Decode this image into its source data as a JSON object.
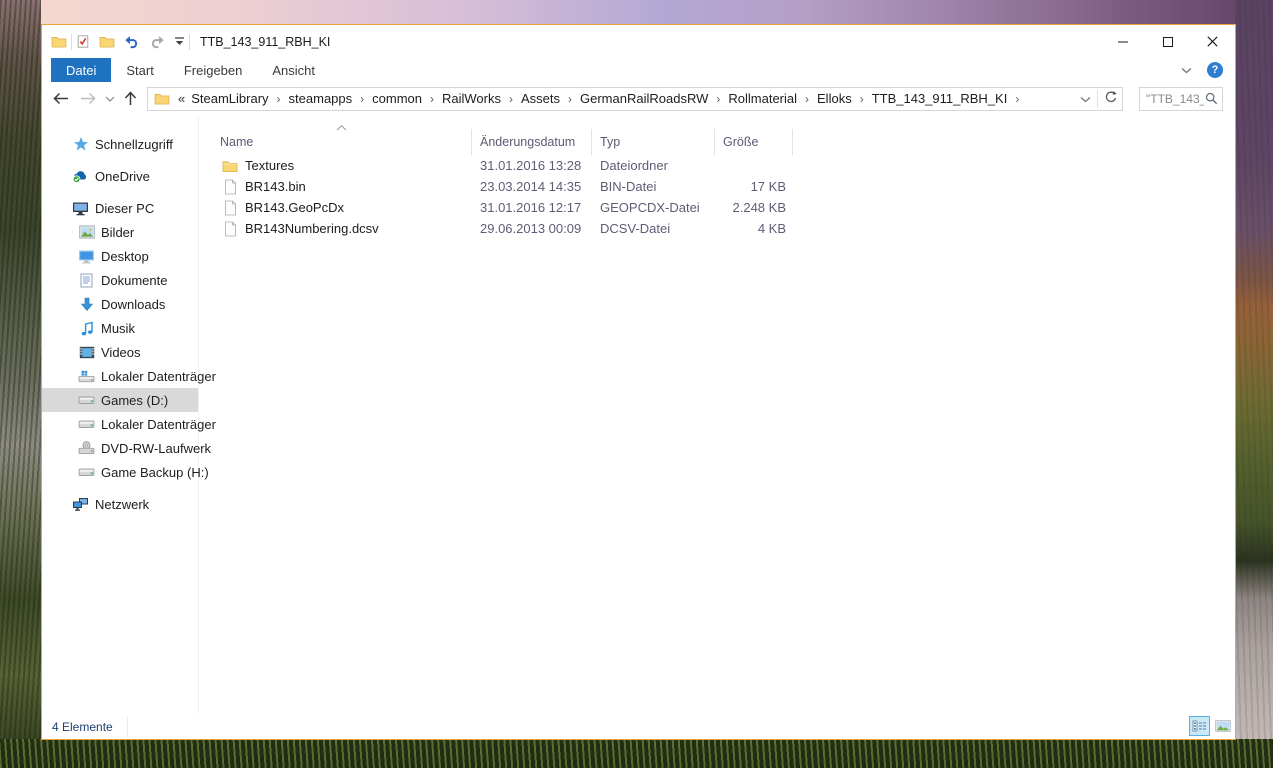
{
  "colors": {
    "accent_blue": "#1f72bf",
    "window_border": "#e8a33d",
    "sidebar_selection": "#d9d9d9",
    "view_toggle_selected_bg": "#cbe8f8",
    "view_toggle_selected_border": "#55b2e4"
  },
  "window": {
    "title": "TTB_143_911_RBH_KI",
    "app_icon": "explorer-folder-icon",
    "qat_icons": [
      "properties-icon",
      "new-folder-icon",
      "undo-icon",
      "redo-icon",
      "qat-dropdown-icon"
    ],
    "controls": [
      {
        "name": "minimize-button",
        "icon": "minimize-icon"
      },
      {
        "name": "maximize-button",
        "icon": "maximize-icon"
      },
      {
        "name": "close-button",
        "icon": "close-icon"
      }
    ]
  },
  "ribbon": {
    "tabs": [
      {
        "label": "Datei",
        "active": true
      },
      {
        "label": "Start",
        "active": false
      },
      {
        "label": "Freigeben",
        "active": false
      },
      {
        "label": "Ansicht",
        "active": false
      }
    ],
    "right_icons": [
      "ribbon-collapse-chevron-icon",
      "help-icon"
    ],
    "help_glyph": "?"
  },
  "toolbar": {
    "nav_icons": [
      "back-arrow-icon",
      "forward-arrow-icon",
      "recent-locations-chevron-icon",
      "up-arrow-icon"
    ],
    "breadcrumb": {
      "icon": "address-folder-icon",
      "prefix": "«",
      "segments": [
        "SteamLibrary",
        "steamapps",
        "common",
        "RailWorks",
        "Assets",
        "GermanRailRoadsRW",
        "Rollmaterial",
        "Elloks",
        "TTB_143_911_RBH_KI"
      ],
      "trailing_separator": "›"
    },
    "address_end_icons": [
      "address-dropdown-chevron-icon",
      "refresh-icon"
    ],
    "search": {
      "value": "\"TTB_143_...",
      "icon": "search-icon"
    }
  },
  "sidebar": {
    "items": [
      {
        "label": "Schnellzugriff",
        "icon": "quick-access-star-icon",
        "level": 0,
        "selected": false,
        "gap_before": false
      },
      {
        "label": "OneDrive",
        "icon": "onedrive-cloud-icon",
        "level": 0,
        "selected": false,
        "gap_before": true
      },
      {
        "label": "Dieser PC",
        "icon": "this-pc-icon",
        "level": 0,
        "selected": false,
        "gap_before": true
      },
      {
        "label": "Bilder",
        "icon": "pictures-icon",
        "level": 1,
        "selected": false,
        "gap_before": false
      },
      {
        "label": "Desktop",
        "icon": "desktop-icon",
        "level": 1,
        "selected": false,
        "gap_before": false
      },
      {
        "label": "Dokumente",
        "icon": "documents-icon",
        "level": 1,
        "selected": false,
        "gap_before": false
      },
      {
        "label": "Downloads",
        "icon": "downloads-icon",
        "level": 1,
        "selected": false,
        "gap_before": false
      },
      {
        "label": "Musik",
        "icon": "music-icon",
        "level": 1,
        "selected": false,
        "gap_before": false
      },
      {
        "label": "Videos",
        "icon": "videos-icon",
        "level": 1,
        "selected": false,
        "gap_before": false
      },
      {
        "label": "Lokaler Datenträger",
        "icon": "system-drive-icon",
        "level": 1,
        "selected": false,
        "gap_before": false
      },
      {
        "label": "Games (D:)",
        "icon": "drive-icon",
        "level": 1,
        "selected": true,
        "gap_before": false
      },
      {
        "label": "Lokaler Datenträger",
        "icon": "drive-icon",
        "level": 1,
        "selected": false,
        "gap_before": false
      },
      {
        "label": "DVD-RW-Laufwerk",
        "icon": "dvd-drive-icon",
        "level": 1,
        "selected": false,
        "gap_before": false
      },
      {
        "label": "Game Backup  (H:)",
        "icon": "drive-icon",
        "level": 1,
        "selected": false,
        "gap_before": false
      },
      {
        "label": "Netzwerk",
        "icon": "network-icon",
        "level": 0,
        "selected": false,
        "gap_before": true
      }
    ]
  },
  "filelist": {
    "columns": [
      "Name",
      "Änderungsdatum",
      "Typ",
      "Größe"
    ],
    "sort": {
      "column": "Name",
      "direction": "ascending"
    },
    "rows": [
      {
        "name": "Textures",
        "icon": "folder-icon",
        "date": "31.01.2016 13:28",
        "type": "Dateiordner",
        "size": ""
      },
      {
        "name": "BR143.bin",
        "icon": "file-icon",
        "date": "23.03.2014 14:35",
        "type": "BIN-Datei",
        "size": "17 KB"
      },
      {
        "name": "BR143.GeoPcDx",
        "icon": "file-icon",
        "date": "31.01.2016 12:17",
        "type": "GEOPCDX-Datei",
        "size": "2.248 KB"
      },
      {
        "name": "BR143Numbering.dcsv",
        "icon": "file-icon",
        "date": "29.06.2013 00:09",
        "type": "DCSV-Datei",
        "size": "4 KB"
      }
    ]
  },
  "statusbar": {
    "items_count": "4 Elemente",
    "view_toggles": [
      {
        "name": "details-view-button",
        "icon": "details-view-icon",
        "selected": true
      },
      {
        "name": "large-icons-view-button",
        "icon": "thumbnail-view-icon",
        "selected": false
      }
    ]
  }
}
